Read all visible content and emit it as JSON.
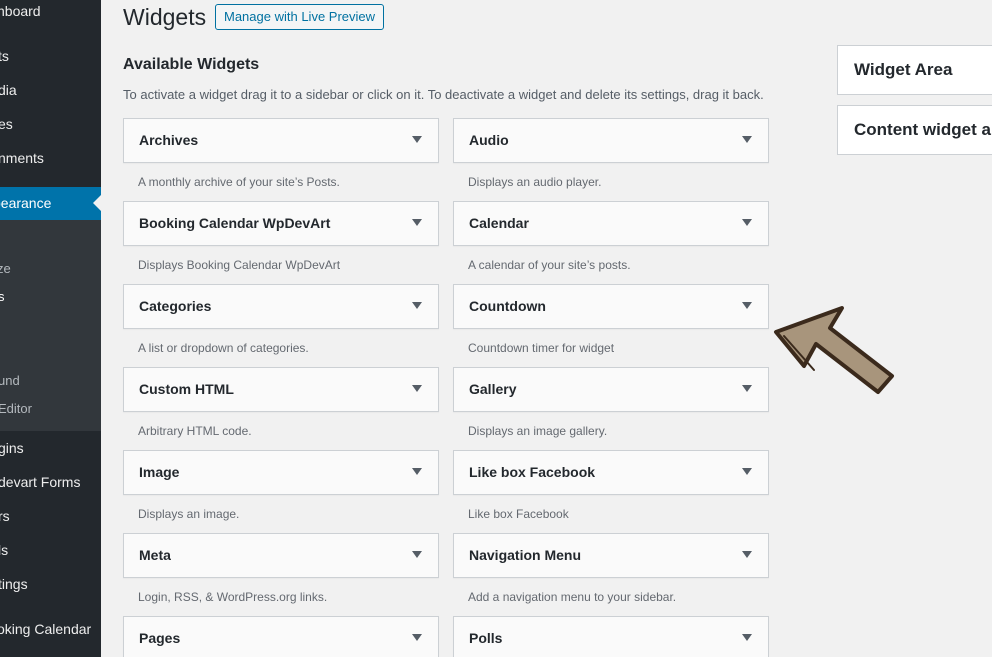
{
  "sidebar": {
    "items": [
      {
        "label": "hboard"
      },
      {
        "label": "ts"
      },
      {
        "label": "dia"
      },
      {
        "label": "es"
      },
      {
        "label": "nments"
      },
      {
        "label": "pearance"
      },
      {
        "label": "ze"
      },
      {
        "label": "s"
      },
      {
        "label": "und"
      },
      {
        "label": "Editor"
      },
      {
        "label": "gins"
      },
      {
        "label": "devart Forms"
      },
      {
        "label": "rs"
      },
      {
        "label": "ls"
      },
      {
        "label": "tings"
      },
      {
        "label": "oking Calendar"
      }
    ]
  },
  "header": {
    "title": "Widgets",
    "live_preview": "Manage with Live Preview"
  },
  "available": {
    "title": "Available Widgets",
    "description": "To activate a widget drag it to a sidebar or click on it. To deactivate a widget and delete its settings, drag it back."
  },
  "widgets": [
    {
      "name": "Archives",
      "desc": "A monthly archive of your site’s Posts."
    },
    {
      "name": "Audio",
      "desc": "Displays an audio player."
    },
    {
      "name": "Booking Calendar WpDevArt",
      "desc": "Displays Booking Calendar WpDevArt"
    },
    {
      "name": "Calendar",
      "desc": "A calendar of your site’s posts."
    },
    {
      "name": "Categories",
      "desc": "A list or dropdown of categories."
    },
    {
      "name": "Countdown",
      "desc": "Countdown timer for widget"
    },
    {
      "name": "Custom HTML",
      "desc": "Arbitrary HTML code."
    },
    {
      "name": "Gallery",
      "desc": "Displays an image gallery."
    },
    {
      "name": "Image",
      "desc": "Displays an image."
    },
    {
      "name": "Like box Facebook",
      "desc": "Like box Facebook"
    },
    {
      "name": "Meta",
      "desc": "Login, RSS, & WordPress.org links."
    },
    {
      "name": "Navigation Menu",
      "desc": "Add a navigation menu to your sidebar."
    },
    {
      "name": "Pages",
      "desc": ""
    },
    {
      "name": "Polls",
      "desc": ""
    }
  ],
  "widget_areas": [
    {
      "title": "Widget Area"
    },
    {
      "title": "Content widget ar"
    }
  ],
  "colors": {
    "admin_menu_bg": "#23282d",
    "admin_menu_current": "#0073aa",
    "annotation_arrow_fill": "#a8957c",
    "annotation_arrow_stroke": "#3b2a1c"
  }
}
